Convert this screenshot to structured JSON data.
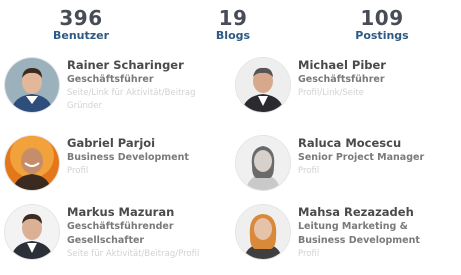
{
  "stats": [
    {
      "value": "396",
      "label": "Benutzer"
    },
    {
      "value": "19",
      "label": "Blogs"
    },
    {
      "value": "109",
      "label": "Postings"
    }
  ],
  "people": [
    {
      "name": "Rainer Scharinger",
      "role": "Geschäftsführer",
      "muted": [
        "Seite/Link für Aktivität/Beitrag",
        "Gründer"
      ]
    },
    {
      "name": "Michael Piber",
      "role": "Geschäftsführer",
      "muted": [
        "Profil/Link/Seite"
      ]
    },
    {
      "name": "Gabriel Parjoi",
      "role": "Business Development",
      "muted": [
        "Profil"
      ]
    },
    {
      "name": "Raluca Mocescu",
      "role": "Senior Project Manager",
      "muted": [
        "Profil"
      ]
    },
    {
      "name": "Markus Mazuran",
      "role": "Geschäftsführender Gesellschafter",
      "muted": [
        "Seite für Aktivität/Beitrag/Profil"
      ]
    },
    {
      "name": "Mahsa Rezazadeh",
      "role": "Leitung Marketing & Business Development",
      "muted": [
        "Profil"
      ]
    }
  ]
}
